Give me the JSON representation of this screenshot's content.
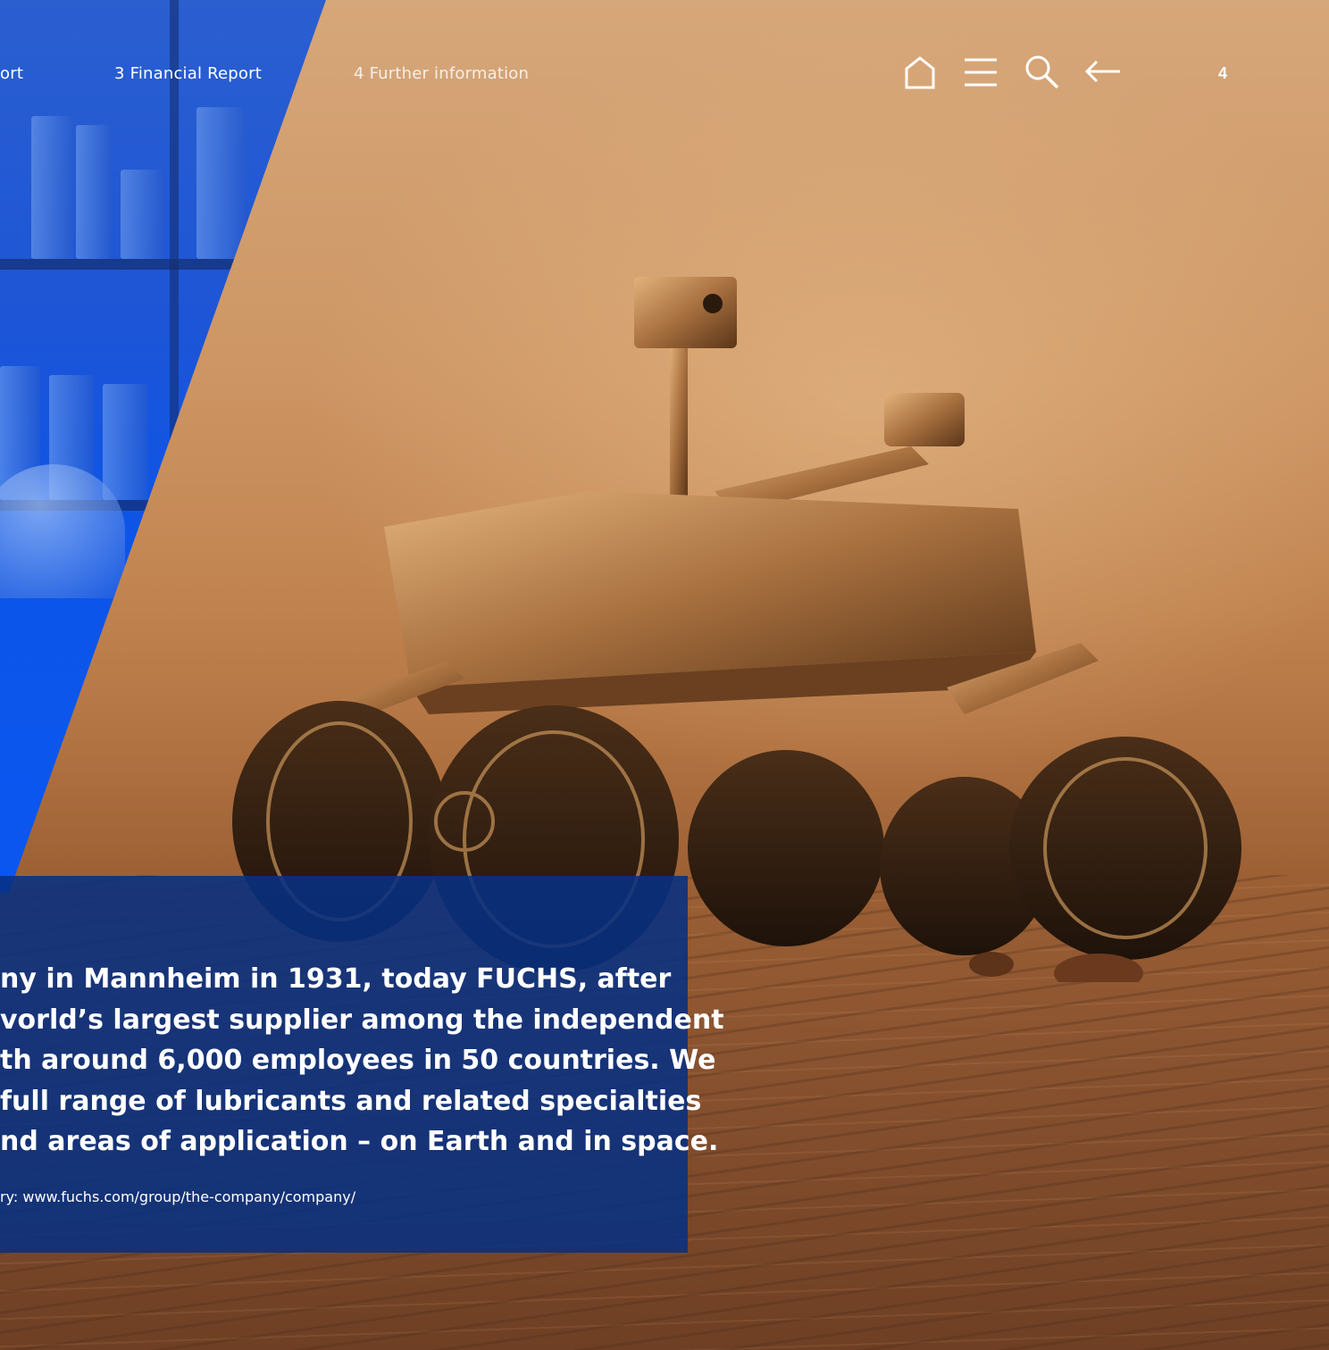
{
  "nav": {
    "links": [
      {
        "label": "ort"
      },
      {
        "label": "3  Financial Report"
      },
      {
        "label": "4  Further information"
      }
    ],
    "icons": [
      "home-icon",
      "menu-icon",
      "search-icon",
      "back-arrow-icon"
    ],
    "page_number": "4"
  },
  "statement": {
    "lines": [
      "ny in Mannheim in 1931, today FUCHS, after",
      "vorld’s largest supplier among the independent",
      "th around 6,000 employees in 50 countries. We",
      " full range of lubricants and related specialties",
      "nd areas of application – on Earth and in space."
    ],
    "source": "ry: www.fuchs.com/group/the-company/company/"
  },
  "colors": {
    "accent_blue": "#0a56f0",
    "panel_blue": "#073082",
    "mars": "#c98a52"
  }
}
